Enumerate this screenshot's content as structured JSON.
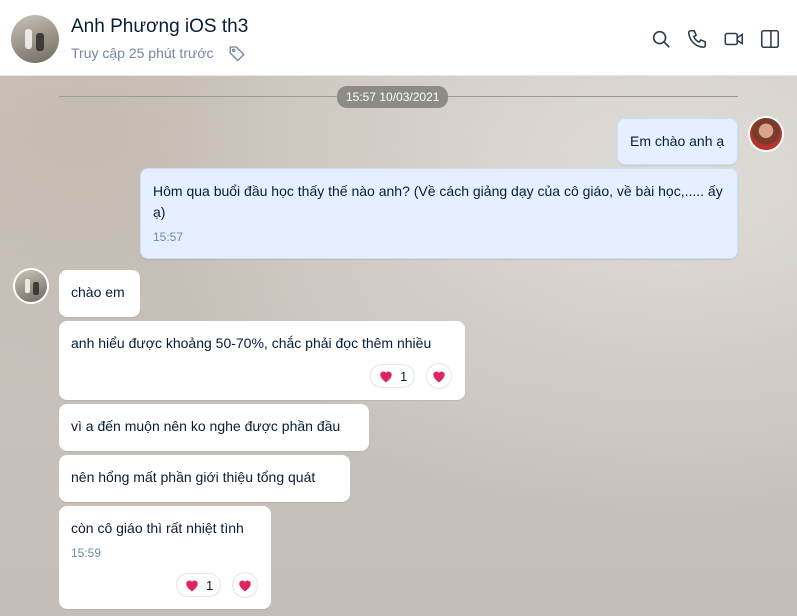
{
  "header": {
    "title": "Anh Phương iOS th3",
    "status": "Truy cập 25 phút trước"
  },
  "chat": {
    "date_divider": "15:57 10/03/2021",
    "messages": [
      {
        "from": "me",
        "text": "Em chào anh ạ"
      },
      {
        "from": "me",
        "text": "Hôm qua buổi đầu học thấy thế nào anh? (Về cách giảng dạy của cô giáo, về bài học,..... ấy ạ)",
        "time": "15:57"
      },
      {
        "from": "them",
        "text": "chào em"
      },
      {
        "from": "them",
        "text": "anh hiểu được khoảng 50-70%, chắc phải đọc thêm nhiều",
        "reaction_count": "1"
      },
      {
        "from": "them",
        "text": "vì a đến muộn nên ko nghe được phần đầu"
      },
      {
        "from": "them",
        "text": "nên hổng mất phần giới thiệu tổng quát"
      },
      {
        "from": "them",
        "text": "còn cô giáo thì rất nhiệt tình",
        "time": "15:59",
        "reaction_count": "1"
      }
    ]
  },
  "icons": {
    "tag": "tag-icon",
    "search": "search-icon",
    "call": "phone-icon",
    "video": "video-camera-icon",
    "panel": "sidebar-toggle-icon",
    "reaction": "heart-icon"
  },
  "colors": {
    "title": "#081c36",
    "subtle": "#7589a3",
    "bubble_out": "#e5efff",
    "bubble_in": "#ffffff",
    "heart": "#e0245e"
  }
}
